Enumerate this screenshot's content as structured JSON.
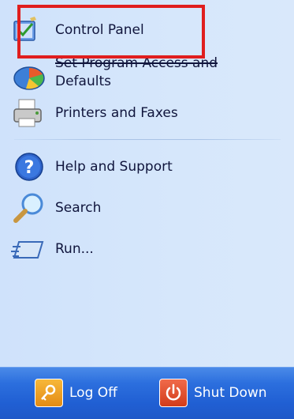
{
  "menu": {
    "items": [
      {
        "label": "Control Panel",
        "icon": "control-panel-icon"
      },
      {
        "label_line1": "Set Program Access and",
        "label_line2": "Defaults",
        "icon": "program-access-icon"
      },
      {
        "label": "Printers and Faxes",
        "icon": "printer-icon"
      },
      {
        "label": "Help and Support",
        "icon": "help-icon"
      },
      {
        "label": "Search",
        "icon": "search-icon"
      },
      {
        "label": "Run...",
        "icon": "run-icon"
      }
    ]
  },
  "footer": {
    "log_off": "Log Off",
    "shut_down": "Shut Down"
  },
  "colors": {
    "panel_bg": "#d3e5fa",
    "footer_bg": "#2c6fde",
    "highlight_border": "#e01e1e"
  }
}
